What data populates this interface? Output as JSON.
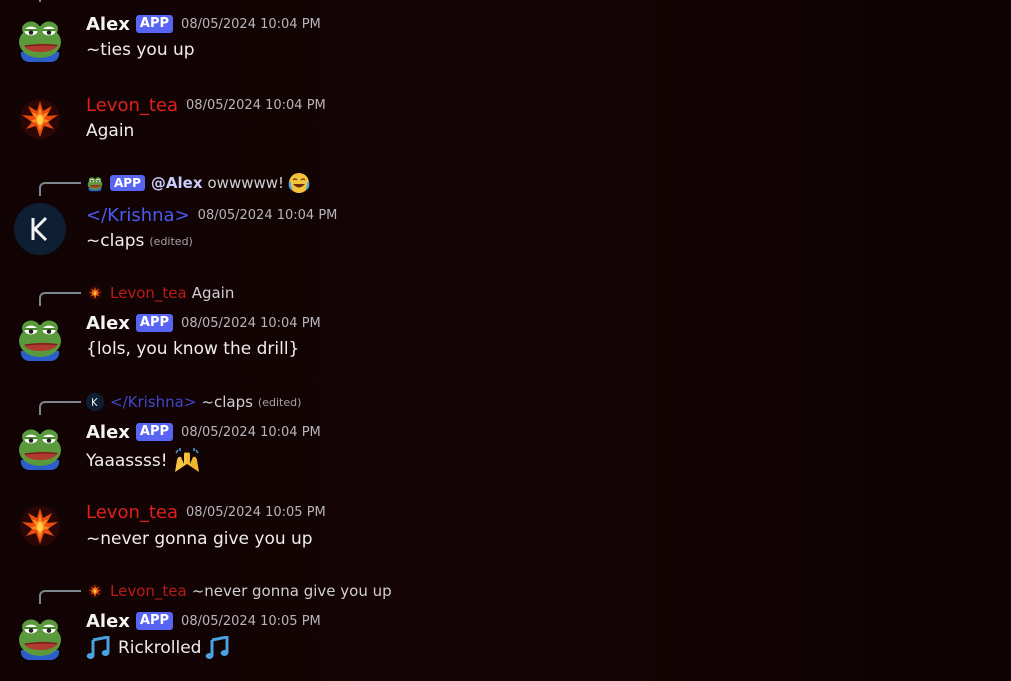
{
  "colors": {
    "alex": "#f4f4f5",
    "levon": "#e0201c",
    "krishna": "#4a5af0",
    "app_tag": "#5865f2"
  },
  "messages": [
    {
      "author": "Alex",
      "tag": "APP",
      "timestamp": "08/05/2024 10:04 PM",
      "text": "~ties you up",
      "avatar_icon": "pepe-frog-avatar-icon"
    },
    {
      "author": "Levon_tea",
      "timestamp": "08/05/2024 10:04 PM",
      "text": "Again",
      "avatar_icon": "phoenix-avatar-icon"
    },
    {
      "reply": {
        "tag": "APP",
        "mention": "@Alex",
        "text": "owwwww!",
        "emoji": "joy-emoji-icon"
      },
      "author": "</Krishna>",
      "timestamp": "08/05/2024 10:04 PM",
      "text": "~claps",
      "edited": "(edited)",
      "avatar_letter": "K"
    },
    {
      "reply": {
        "name": "Levon_tea",
        "text": "Again"
      },
      "author": "Alex",
      "tag": "APP",
      "timestamp": "08/05/2024 10:04 PM",
      "text": "{lols, you know the drill}"
    },
    {
      "reply": {
        "name": "</Krishna>",
        "text": "~claps",
        "edited": "(edited)",
        "avatar_letter": "K"
      },
      "author": "Alex",
      "tag": "APP",
      "timestamp": "08/05/2024 10:04 PM",
      "text": "Yaaassss!",
      "emoji": "raised-hands-emoji-icon"
    },
    {
      "author": "Levon_tea",
      "timestamp": "08/05/2024 10:05 PM",
      "text": "~never gonna give you up"
    },
    {
      "reply": {
        "name": "Levon_tea",
        "text": "~never gonna give you up"
      },
      "author": "Alex",
      "tag": "APP",
      "timestamp": "08/05/2024 10:05 PM",
      "text": "Rickrolled",
      "emoji": "musical-notes-emoji-icon"
    }
  ]
}
